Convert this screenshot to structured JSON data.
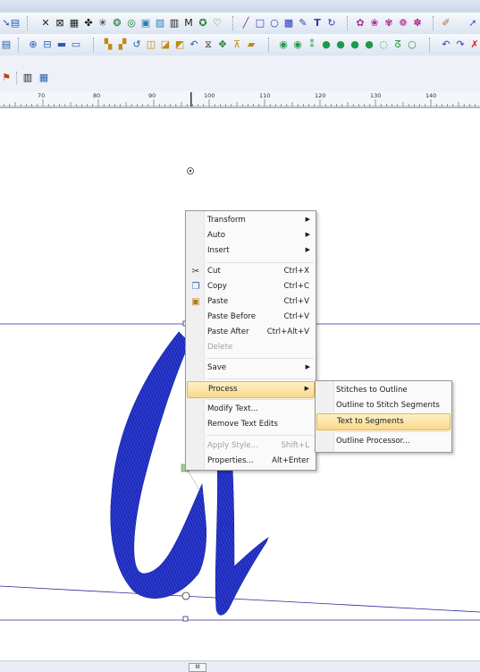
{
  "ruler": {
    "labels": [
      "70",
      "80",
      "90",
      "100",
      "110",
      "120",
      "130",
      "140"
    ]
  },
  "status": {
    "scroll_thumb": "III"
  },
  "context_menu": {
    "items": [
      {
        "label": "Transform",
        "submenu": true
      },
      {
        "label": "Auto",
        "submenu": true
      },
      {
        "label": "Insert",
        "submenu": true
      },
      {
        "label": "Cut",
        "shortcut": "Ctrl+X",
        "icon": "scissors-icon"
      },
      {
        "label": "Copy",
        "shortcut": "Ctrl+C",
        "icon": "copy-icon"
      },
      {
        "label": "Paste",
        "shortcut": "Ctrl+V",
        "icon": "paste-icon"
      },
      {
        "label": "Paste Before",
        "shortcut": "Ctrl+V"
      },
      {
        "label": "Paste After",
        "shortcut": "Ctrl+Alt+V"
      },
      {
        "label": "Delete",
        "disabled": true
      },
      {
        "label": "Save",
        "submenu": true
      },
      {
        "label": "Process",
        "submenu": true,
        "highlighted": true
      },
      {
        "label": "Modify Text..."
      },
      {
        "label": "Remove Text Edits"
      },
      {
        "label": "Apply Style...",
        "shortcut": "Shift+L",
        "disabled": true
      },
      {
        "label": "Properties...",
        "shortcut": "Alt+Enter"
      }
    ]
  },
  "process_submenu": {
    "items": [
      {
        "label": "Stitches to Outline"
      },
      {
        "label": "Outline to Stitch Segments"
      },
      {
        "label": "Text to Segments",
        "highlighted": true
      },
      {
        "label": "Outline Processor..."
      }
    ]
  },
  "colors": {
    "stitch_blue": "#1f2fc4",
    "highlight": "#f9d989",
    "guide_line": "#2a2a9a"
  }
}
